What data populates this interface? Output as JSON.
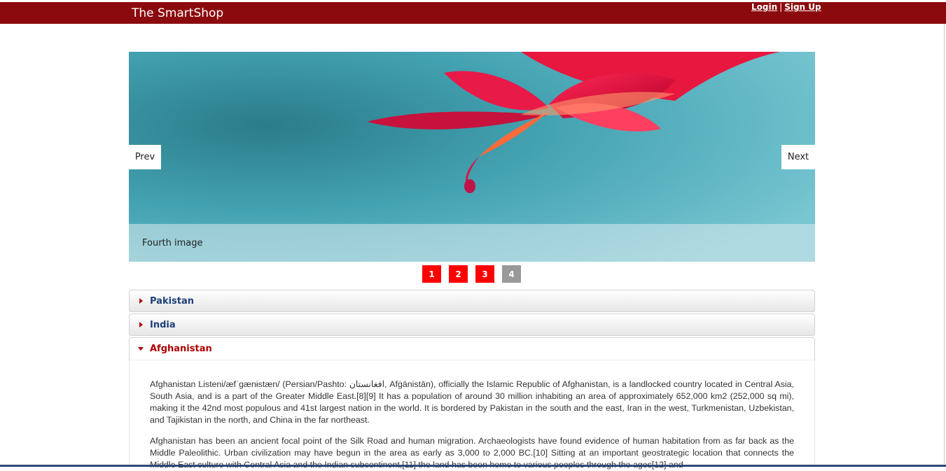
{
  "header": {
    "brand": "The SmartShop",
    "login": "Login",
    "separator": "|",
    "signup": "Sign Up",
    "color": "#8b0a0d"
  },
  "slider": {
    "prev_label": "Prev",
    "next_label": "Next",
    "caption": "Fourth image",
    "pages": [
      "1",
      "2",
      "3",
      "4"
    ],
    "active_page": "4",
    "page_color": "#ff0000",
    "active_page_color": "#999999"
  },
  "accordion": {
    "items": [
      {
        "label": "Pakistan",
        "expanded": false
      },
      {
        "label": "India",
        "expanded": false
      },
      {
        "label": "Afghanistan",
        "expanded": true
      }
    ],
    "content": {
      "paragraph1": "Afghanistan Listeni/æfˈɡænɨstæn/ (Persian/Pashto: افغانستان, Afġānistān), officially the Islamic Republic of Afghanistan, is a landlocked country located in Central Asia, South Asia, and is a part of the Greater Middle East.[8][9] It has a population of around 30 million inhabiting an area of approximately 652,000 km2 (252,000 sq mi), making it the 42nd most populous and 41st largest nation in the world. It is bordered by Pakistan in the south and the east, Iran in the west, Turkmenistan, Uzbekistan, and Tajikistan in the north, and China in the far northeast.",
      "paragraph2": "Afghanistan has been an ancient focal point of the Silk Road and human migration. Archaeologists have found evidence of human habitation from as far back as the Middle Paleolithic. Urban civilization may have begun in the area as early as 3,000 to 2,000 BC.[10] Sitting at an important geostrategic location that connects the Middle East culture with Central Asia and the Indian subcontinent,[11] the land has been home to various peoples through the ages[12] and"
    }
  }
}
